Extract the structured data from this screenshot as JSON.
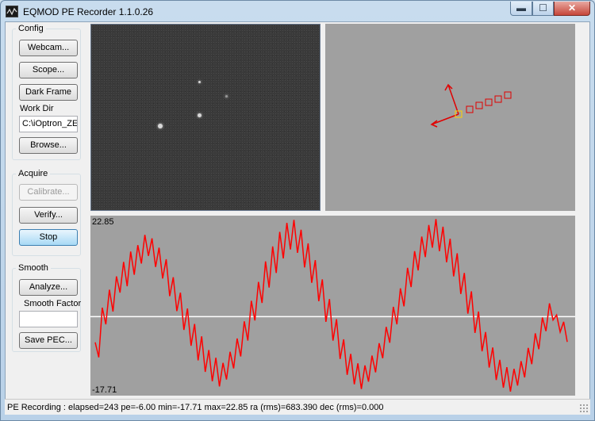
{
  "window": {
    "title": "EQMOD PE Recorder 1.1.0.26",
    "min_glyph": "▬",
    "max_glyph": "☐",
    "close_glyph": "✕"
  },
  "config": {
    "group_label": "Config",
    "webcam_label": "Webcam...",
    "scope_label": "Scope...",
    "dark_frame_label": "Dark Frame",
    "work_dir_label": "Work Dir",
    "work_dir_value": "C:\\iOptron_ZE",
    "browse_label": "Browse..."
  },
  "acquire": {
    "group_label": "Acquire",
    "calibrate_label": "Calibrate...",
    "verify_label": "Verify...",
    "stop_label": "Stop"
  },
  "smooth": {
    "group_label": "Smooth",
    "analyze_label": "Analyze...",
    "smooth_factor_label": "Smooth Factor",
    "smooth_factor_value": "",
    "save_pec_label": "Save PEC..."
  },
  "graph": {
    "max_label": "22.85",
    "min_label": "-17.71",
    "color": "#ff0000",
    "zero_line_color": "#ffffff"
  },
  "status": {
    "text": "PE Recording :  elapsed=243 pe=-6.00 min=-17.71 max=22.85 ra (rms)=683.390 dec (rms)=0.000"
  },
  "chart_data": {
    "type": "line",
    "title": "",
    "xlabel": "",
    "ylabel": "",
    "ylim": [
      -17.71,
      22.85
    ],
    "series": [
      {
        "values": [
          -6.0,
          -9.5,
          2.1,
          -1.8,
          6.3,
          1.2,
          9.4,
          5.6,
          12.8,
          7.1,
          15.2,
          9.8,
          16.7,
          12.4,
          19.1,
          14.2,
          18.3,
          11.6,
          16.1,
          8.9,
          13.4,
          4.8,
          9.2,
          1.3,
          5.6,
          -3.1,
          1.9,
          -6.8,
          -1.7,
          -10.2,
          -4.6,
          -12.9,
          -7.8,
          -15.1,
          -9.6,
          -16.3,
          -10.8,
          -14.7,
          -8.2,
          -12.1,
          -5.1,
          -9.3,
          -1.1,
          -5.6,
          3.7,
          -0.9,
          8.1,
          3.2,
          12.9,
          6.8,
          16.4,
          10.2,
          19.8,
          13.6,
          21.9,
          15.7,
          22.6,
          14.9,
          20.3,
          11.5,
          17.1,
          7.9,
          13.2,
          3.6,
          8.7,
          -1.2,
          4.1,
          -5.6,
          -0.6,
          -9.9,
          -5.3,
          -13.6,
          -8.7,
          -15.8,
          -10.9,
          -16.9,
          -11.4,
          -15.2,
          -9.1,
          -13.0,
          -6.2,
          -9.7,
          -2.4,
          -6.1,
          2.3,
          -1.8,
          6.6,
          2.4,
          11.4,
          6.9,
          15.3,
          10.8,
          18.7,
          13.9,
          21.4,
          16.1,
          22.8,
          15.3,
          21.0,
          12.7,
          18.2,
          9.4,
          14.8,
          5.3,
          10.2,
          0.7,
          5.9,
          -3.8,
          1.2,
          -8.1,
          -3.6,
          -11.9,
          -7.2,
          -14.8,
          -10.1,
          -16.6,
          -11.8,
          -17.5,
          -12.2,
          -16.1,
          -10.4,
          -14.2,
          -7.3,
          -11.1,
          -3.9,
          -7.6,
          -0.2,
          -3.4,
          3.1,
          -0.8,
          0.4,
          -3.6,
          -1.2,
          -5.9
        ]
      }
    ]
  }
}
